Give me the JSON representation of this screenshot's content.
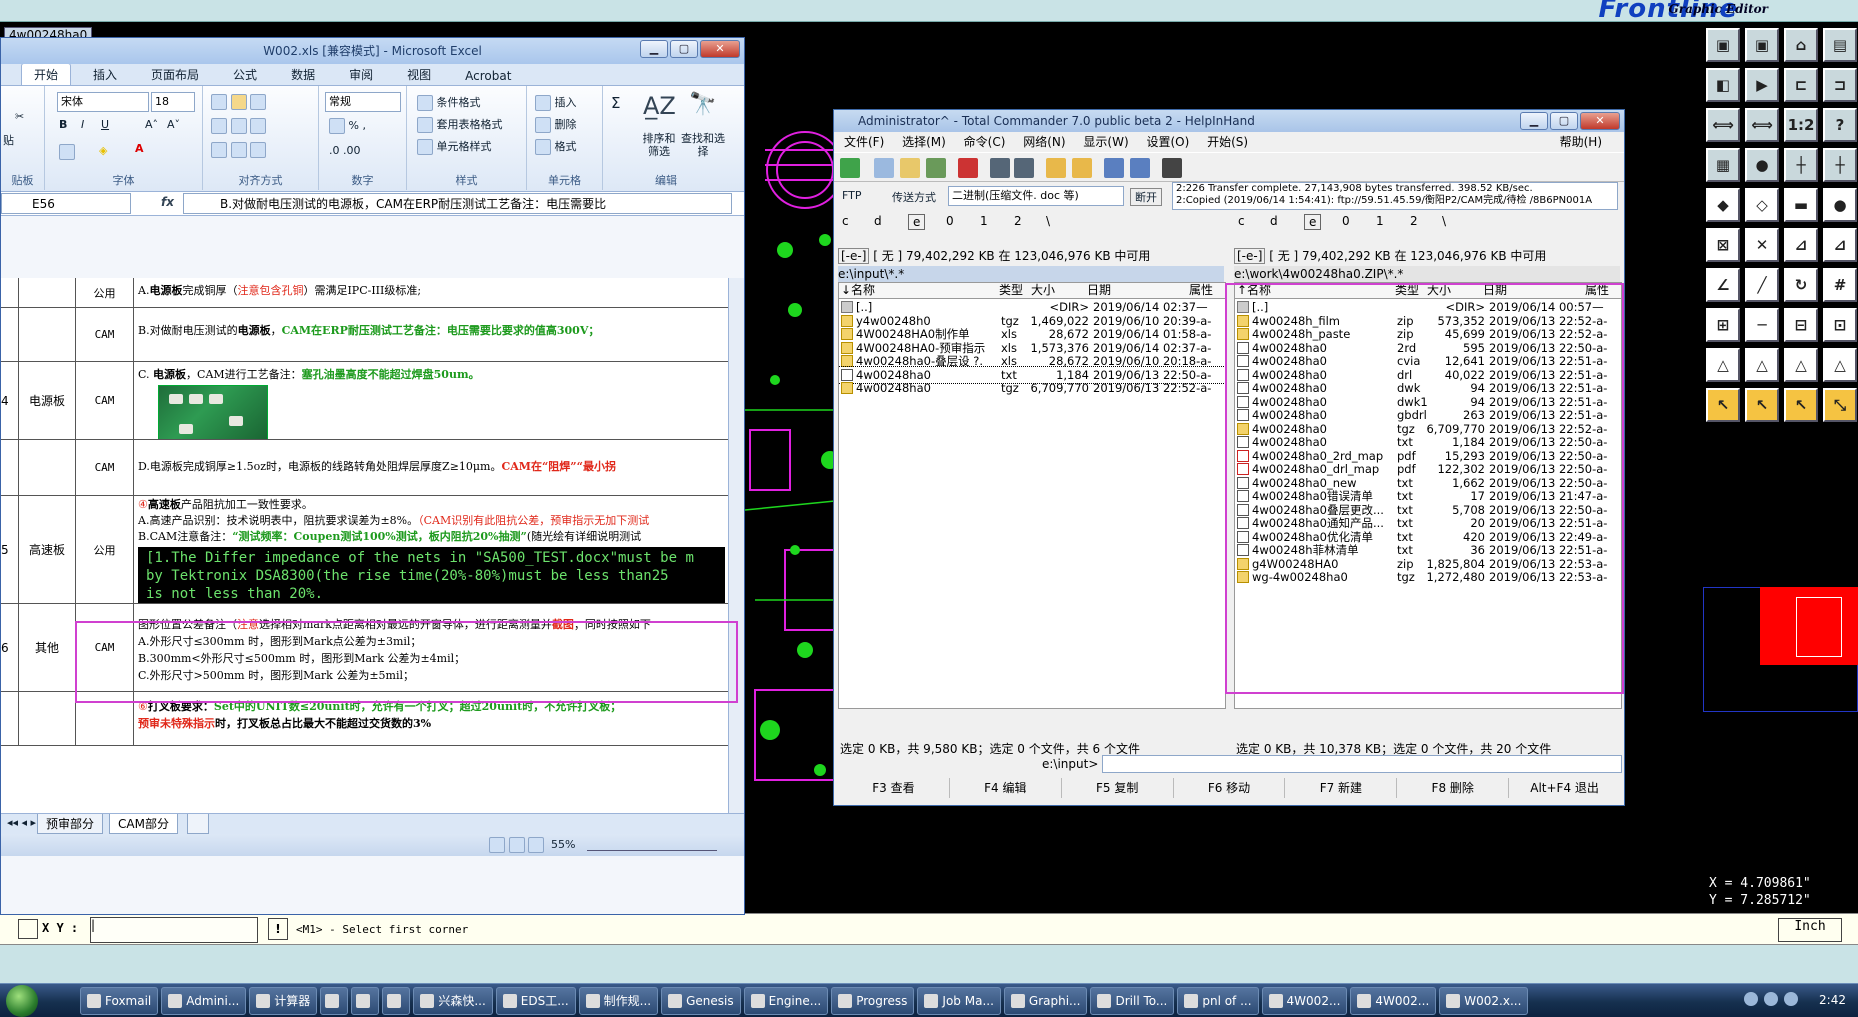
{
  "genesis": {
    "logo": "Frontline",
    "subtitle": "Graphic Editor",
    "job_tag": "4w00248ha0",
    "coord_x": "X = 4.709861\"",
    "coord_y": "Y = 7.285712\"",
    "xy_label": "X Y :",
    "xy_value": "|",
    "msg_icon": "!",
    "message": "<M1> - Select first corner",
    "units": "Inch",
    "tool_rows": [
      [
        "▣",
        "▣",
        "⌂",
        "▤"
      ],
      [
        "◧",
        "▶",
        "⊏",
        "⊐"
      ],
      [
        "⟺",
        "⟺",
        "1:2",
        "?"
      ],
      [
        "▦",
        "●",
        "┼",
        "┼"
      ],
      [
        "◆",
        "◇",
        "▬",
        "●"
      ],
      [
        "⊠",
        "✕",
        "⊿",
        "⊿"
      ],
      [
        "∠",
        "╱",
        "↻",
        "#"
      ],
      [
        "⊞",
        "─",
        "⊟",
        "⊡"
      ],
      [
        "△",
        "△",
        "△",
        "△"
      ],
      [
        "↖",
        "↖",
        "↖",
        "⤡"
      ]
    ]
  },
  "excel": {
    "title": "W002.xls  [兼容模式]  -  Microsoft Excel",
    "tabs": [
      "开始",
      "插入",
      "页面布局",
      "公式",
      "数据",
      "审阅",
      "视图",
      "Acrobat"
    ],
    "ribbon": {
      "font_name": "宋体",
      "font_size": "18",
      "number_format": "常规",
      "cond_format": "条件格式",
      "table_format": "套用表格格式",
      "cell_style": "单元格样式",
      "insert": "插入",
      "delete": "删除",
      "format": "格式",
      "sort": "排序和筛选",
      "find": "查找和选择",
      "groups": [
        "字体",
        "对齐方式",
        "数字",
        "样式",
        "单元格",
        "编辑"
      ],
      "paste_label": "贴",
      "clipboard_label": "贴板"
    },
    "namebox": "E56",
    "formula": "B.对做耐电压测试的电源板，CAM在ERP耐压测试工艺备注：电压需要比",
    "rows": {
      "r1": {
        "c": "公用",
        "d1": "A.",
        "d2": "电源板",
        "d3": "完成铜厚（",
        "d4": "注意包含孔铜",
        "d5": "）需满足IPC-III级标准;"
      },
      "r2": {
        "c": "CAM",
        "d1": "B.对做耐电压测试的",
        "d2": "电源板",
        "d3": "，",
        "d4": "CAM在ERP耐压测试工艺备注：电压需要比要求的值高300V；"
      },
      "r3": {
        "c": "CAM",
        "d1": "C. ",
        "d2": "电源板",
        "d3": "，CAM进行工艺备注：",
        "d4": "塞孔油墨高度不能超过焊盘50um。"
      },
      "r4": {
        "c": "CAM",
        "d1": "D.电源板完成铜厚≥1.5oz时，电源板的线路转角处阻焊层厚度Z≥10μm。",
        "d2": "CAM在“阻焊”“最小拐"
      },
      "r14_a": "4",
      "r14_b": "电源板",
      "r15_a": "5",
      "r15_b": "高速板",
      "r15_c": "公用",
      "r15": {
        "d1": "④",
        "d2": "高速板",
        "d3": "产品阻抗加工一致性要求。",
        "d4": "A.高速产品识别：技术说明表中，阻抗要求误差为±8%。",
        "d5": "（CAM识别有此阻抗公差，预审指示无加下测试",
        "d6": "B.CAM注意备注：",
        "d7": "“测试频率：Coupen测试100%测试，板内阻抗20%抽测”",
        "d8": "(随光绘有详细说明测试"
      },
      "code1": "[1.The Differ impedance of the nets in \"SA500_TEST.docx\"must be m",
      "code2": "    by Tektronix DSA8300(the rise time(20%-80%)must be less than25",
      "code3": "    is not less than 20%.",
      "r16_a": "6",
      "r16_b": "其他",
      "r16_c": "CAM",
      "r16": {
        "d1": "图形位置公差备注（",
        "d2": "注意",
        "d3": "选择相对mark点距离相对最远的开窗导体，进行距离测量并",
        "d4": "截图",
        "d5": "；同时按照如下",
        "d6": "A.外形尺寸≤300mm 时，图形到Mark点公差为±3mil；",
        "d7": "B.300mm<外形尺寸≤500mm 时，图形到Mark 公差为±4mil；",
        "d8": "C.外形尺寸>500mm 时，图形到Mark 公差为±5mil；"
      },
      "r17": {
        "d1": "⑥",
        "d2": "打叉板要求：",
        "d3": "Set中的UNIT数≤20unit时，允许有一个打叉；超过20unit时，不允许打叉板；",
        "d4": "预审未特殊指示",
        "d5": "时，打叉板总占比最大不能超过交货数的3%"
      }
    },
    "sheets": [
      "预审部分",
      "CAM部分"
    ],
    "zoom": "55%"
  },
  "tc": {
    "title": "Administrator^ - Total Commander 7.0 public beta 2 - HelpInHand",
    "menu": [
      "文件(F)",
      "选择(M)",
      "命令(C)",
      "网络(N)",
      "显示(W)",
      "设置(O)",
      "开始(S)"
    ],
    "help": "帮助(H)",
    "ftp_label": "FTP",
    "transfer_label": "传送方式",
    "transfer_mode": "二进制(压缩文件. doc 等)",
    "disconnect": "断开",
    "log1": "2:226 Transfer complete. 27,143,908 bytes transferred. 398.52 KB/sec.",
    "log2": "2:Copied (2019/06/14 1:54:41): ftp://59.51.45.59/衡阳P2/CAM完成/待检 /8B6PN001A",
    "drives": [
      "c",
      "d",
      "e",
      "0",
      "1",
      "2",
      "\\"
    ],
    "left": {
      "drive": "[-e-]",
      "space": "[ 无 ]  79,402,292 KB 在 123,046,976 KB 中可用",
      "path": "e:\\input\\*.*",
      "status": "选定 0 KB，共 9,580 KB；选定 0 个文件，共 6 个文件",
      "files": [
        {
          "name": "[..]",
          "ext": "",
          "size": "<DIR>",
          "date": "2019/06/14 02:37—",
          "icon": "up"
        },
        {
          "name": "y4w00248h0",
          "ext": "tgz",
          "size": "1,469,022",
          "date": "2019/06/10 20:39-a-",
          "icon": "arc"
        },
        {
          "name": "4W00248HA0制作单",
          "ext": "xls",
          "size": "28,672",
          "date": "2019/06/14 01:58-a-",
          "icon": "arc"
        },
        {
          "name": "4W00248HA0-预审指示",
          "ext": "xls",
          "size": "1,573,376",
          "date": "2019/06/14 02:37-a-",
          "icon": "arc"
        },
        {
          "name": "4w00248ha0-叠层设 ?.",
          "ext": "xls",
          "size": "28,672",
          "date": "2019/06/10 20:18-a-",
          "icon": "arc"
        },
        {
          "name": "4w00248ha0",
          "ext": "txt",
          "size": "1,184",
          "date": "2019/06/13 22:50-a-",
          "icon": "doc"
        },
        {
          "name": "4w00248ha0",
          "ext": "tgz",
          "size": "6,709,770",
          "date": "2019/06/13 22:52-a-",
          "icon": "arc"
        }
      ]
    },
    "right": {
      "drive": "[-e-]",
      "space": "[ 无 ]  79,402,292 KB 在 123,046,976 KB 中可用",
      "path": "e:\\work\\4w00248ha0.ZIP\\*.*",
      "status": "选定 0 KB，共 10,378 KB；选定 0 个文件，共 20 个文件",
      "files": [
        {
          "name": "[..]",
          "ext": "",
          "size": "<DIR>",
          "date": "2019/06/14 00:57—",
          "icon": "up"
        },
        {
          "name": "4w00248h_film",
          "ext": "zip",
          "size": "573,352",
          "date": "2019/06/13 22:52-a-",
          "icon": "arc"
        },
        {
          "name": "4w00248h_paste",
          "ext": "zip",
          "size": "45,699",
          "date": "2019/06/13 22:52-a-",
          "icon": "arc"
        },
        {
          "name": "4w00248ha0",
          "ext": "2rd",
          "size": "595",
          "date": "2019/06/13 22:50-a-",
          "icon": "doc"
        },
        {
          "name": "4w00248ha0",
          "ext": "cvia",
          "size": "12,641",
          "date": "2019/06/13 22:51-a-",
          "icon": "doc"
        },
        {
          "name": "4w00248ha0",
          "ext": "drl",
          "size": "40,022",
          "date": "2019/06/13 22:51-a-",
          "icon": "doc"
        },
        {
          "name": "4w00248ha0",
          "ext": "dwk",
          "size": "94",
          "date": "2019/06/13 22:51-a-",
          "icon": "doc"
        },
        {
          "name": "4w00248ha0",
          "ext": "dwk1",
          "size": "94",
          "date": "2019/06/13 22:51-a-",
          "icon": "doc"
        },
        {
          "name": "4w00248ha0",
          "ext": "gbdrl",
          "size": "263",
          "date": "2019/06/13 22:51-a-",
          "icon": "doc"
        },
        {
          "name": "4w00248ha0",
          "ext": "tgz",
          "size": "6,709,770",
          "date": "2019/06/13 22:52-a-",
          "icon": "arc"
        },
        {
          "name": "4w00248ha0",
          "ext": "txt",
          "size": "1,184",
          "date": "2019/06/13 22:50-a-",
          "icon": "doc"
        },
        {
          "name": "4w00248ha0_2rd_map",
          "ext": "pdf",
          "size": "15,293",
          "date": "2019/06/13 22:50-a-",
          "icon": "pdf"
        },
        {
          "name": "4w00248ha0_drl_map",
          "ext": "pdf",
          "size": "122,302",
          "date": "2019/06/13 22:50-a-",
          "icon": "pdf"
        },
        {
          "name": "4w00248ha0_new",
          "ext": "txt",
          "size": "1,662",
          "date": "2019/06/13 22:50-a-",
          "icon": "doc"
        },
        {
          "name": "4w00248ha0错误清单",
          "ext": "txt",
          "size": "17",
          "date": "2019/06/13 21:47-a-",
          "icon": "doc"
        },
        {
          "name": "4w00248ha0叠层更改...",
          "ext": "txt",
          "size": "5,708",
          "date": "2019/06/13 22:50-a-",
          "icon": "doc"
        },
        {
          "name": "4w00248ha0通知产品...",
          "ext": "txt",
          "size": "20",
          "date": "2019/06/13 22:51-a-",
          "icon": "doc"
        },
        {
          "name": "4w00248ha0优化清单",
          "ext": "txt",
          "size": "420",
          "date": "2019/06/13 22:49-a-",
          "icon": "doc"
        },
        {
          "name": "4w00248h菲林清单",
          "ext": "txt",
          "size": "36",
          "date": "2019/06/13 22:51-a-",
          "icon": "doc"
        },
        {
          "name": "g4W00248HA0",
          "ext": "zip",
          "size": "1,825,804",
          "date": "2019/06/13 22:53-a-",
          "icon": "arc"
        },
        {
          "name": "wg-4w00248ha0",
          "ext": "tgz",
          "size": "1,272,480",
          "date": "2019/06/13 22:53-a-",
          "icon": "arc"
        }
      ]
    },
    "col_name": "↓名称",
    "col_name_r": "↑名称",
    "col_type": "类型",
    "col_size": "大小",
    "col_date": "日期",
    "col_attr": "属性",
    "cmd_path": "e:\\input>",
    "fkeys": [
      "F3 查看",
      "F4 编辑",
      "F5 复制",
      "F6 移动",
      "F7 新建",
      "F8 删除",
      "Alt+F4 退出"
    ]
  },
  "taskbar": {
    "items": [
      "Foxmail",
      "Admini...",
      "计算器",
      "",
      "",
      "",
      "兴森快...",
      "EDS工...",
      "制作规...",
      "Genesis",
      "Engine...",
      "Progress",
      "Job Ma...",
      "Graphi...",
      "Drill To...",
      "pnl of ...",
      "4W002...",
      "4W002...",
      "W002.x..."
    ],
    "clock": "2:42"
  }
}
